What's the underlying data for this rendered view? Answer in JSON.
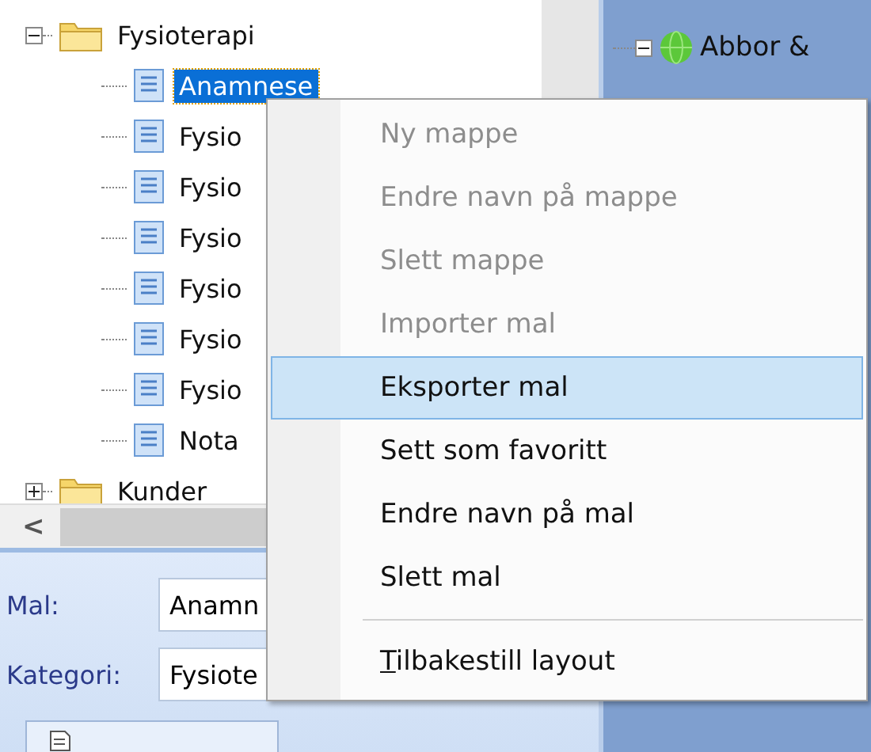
{
  "left_tree": {
    "items": [
      {
        "label": "Fysioterapi",
        "kind": "folder",
        "expanded": true,
        "selected": false,
        "children": [
          {
            "label": "Anamnese",
            "kind": "document",
            "selected": true
          },
          {
            "label": "Fysio",
            "kind": "document",
            "selected": false
          },
          {
            "label": "Fysio",
            "kind": "document",
            "selected": false
          },
          {
            "label": "Fysio",
            "kind": "document",
            "selected": false
          },
          {
            "label": "Fysio",
            "kind": "document",
            "selected": false
          },
          {
            "label": "Fysio",
            "kind": "document",
            "selected": false
          },
          {
            "label": "Fysio",
            "kind": "document",
            "selected": false
          },
          {
            "label": "Nota",
            "kind": "document",
            "selected": false
          }
        ]
      },
      {
        "label": "Kunder",
        "kind": "folder",
        "expanded": false,
        "selected": false
      }
    ]
  },
  "scrollbar": {
    "left_arrow": "<"
  },
  "right_tree": {
    "items": [
      {
        "label": "Abbor &",
        "expanded": true
      }
    ]
  },
  "form": {
    "fields": [
      {
        "label": "Mal:",
        "value": "Anamn"
      },
      {
        "label": "Kategori:",
        "value": "Fysiote"
      }
    ]
  },
  "context_menu": {
    "items": [
      {
        "kind": "item",
        "label": "Ny mappe",
        "disabled": true,
        "selected": false
      },
      {
        "kind": "item",
        "label": "Endre navn på mappe",
        "disabled": true,
        "selected": false
      },
      {
        "kind": "item",
        "label": "Slett mappe",
        "disabled": true,
        "selected": false
      },
      {
        "kind": "item",
        "label": "Importer mal",
        "disabled": true,
        "selected": false
      },
      {
        "kind": "item",
        "label": "Eksporter mal",
        "disabled": false,
        "selected": true
      },
      {
        "kind": "item",
        "label": "Sett som favoritt",
        "disabled": false,
        "selected": false
      },
      {
        "kind": "item",
        "label": "Endre navn på mal",
        "disabled": false,
        "selected": false
      },
      {
        "kind": "item",
        "label": "Slett mal",
        "disabled": false,
        "selected": false
      },
      {
        "kind": "separator"
      },
      {
        "kind": "item",
        "label": "Tilbakestill layout",
        "disabled": false,
        "selected": false,
        "underline_first": true
      }
    ]
  }
}
